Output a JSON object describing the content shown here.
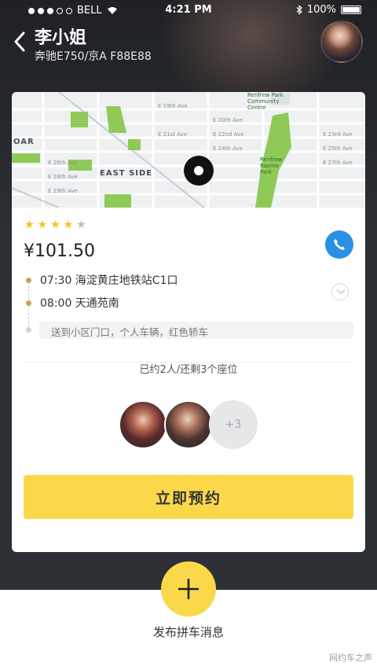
{
  "status_bar": {
    "carrier": "BELL",
    "time": "4:21 PM",
    "battery": "100%"
  },
  "header": {
    "driver_name": "李小姐",
    "car_info": "奔驰E750/京A F88E88"
  },
  "map": {
    "labels": {
      "east_side": "EAST SIDE",
      "oar": "OAR",
      "community": "Renfrew Park Community Centre",
      "ravine": "Renfrew Ravine Park",
      "streets": [
        "E 19th Ave",
        "E 20th Ave",
        "E 21st Ave",
        "E 22nd Ave",
        "E 23rd Ave",
        "E 24th Ave",
        "E 25th Ave",
        "E 26th Ave",
        "E 27th Ave",
        "E 28th Ave",
        "E 29th Ave"
      ]
    }
  },
  "trip": {
    "rating": 4,
    "max_rating": 5,
    "price": "¥101.50",
    "departure": "07:30  海淀黄庄地铁站C1口",
    "arrival": "08:00  天通苑南",
    "remark": "送到小区门口，个人车辆，红色轿车",
    "booked_status": "已约2人/还剩3个座位",
    "more_passengers": "+3",
    "book_button": "立即预约"
  },
  "bottom": {
    "publish_label": "发布拼车消息",
    "watermark": "网约车之声"
  },
  "colors": {
    "accent_yellow": "#fbd84a",
    "phone_blue": "#2a8fe6",
    "star": "#f4c21c",
    "map_green": "#8fca58"
  }
}
